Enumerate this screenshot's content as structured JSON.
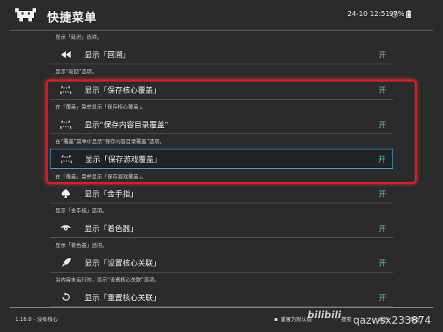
{
  "header": {
    "title": "快捷菜单",
    "clock": "24-10 12:51",
    "battery": "97%"
  },
  "items": [
    {
      "icon": "rewind-icon",
      "label": "显示「回溯」",
      "value": "开",
      "sub": "显示“返回”选项。"
    },
    {
      "icon": "overlay-icon",
      "label": "显示「保存核心覆盖」",
      "value": "开",
      "sub": "在「覆盖」菜单显示「保存核心覆盖」。"
    },
    {
      "icon": "overlay-icon",
      "label": "显示“保存内容目录覆盖”",
      "value": "开",
      "sub": "在“覆盖”菜单中显示“保存内容目录覆盖”选项。"
    },
    {
      "icon": "overlay-icon",
      "label": "显示「保存游戏覆盖」",
      "value": "开",
      "sub": "在「覆盖」菜单显示「保存游戏覆盖」。"
    },
    {
      "icon": "spade-icon",
      "label": "显示「金手指」",
      "value": "开",
      "sub": "显示「金手指」选项。"
    },
    {
      "icon": "eye-icon",
      "label": "显示「着色器」",
      "value": "开",
      "sub": "显示「着色器」选项。"
    },
    {
      "icon": "rocket-icon",
      "label": "显示「设置核心关联」",
      "value": "开",
      "sub": "当内容未运行时，显示“设置核心关联”选项。"
    },
    {
      "icon": "reset-icon",
      "label": "显示「重置核心关联」",
      "value": "开"
    }
  ],
  "top_sub": "显示「延迟」选项。",
  "footer": {
    "version": "1.16.0 - 没有核心",
    "reset_label": "重置为默认值",
    "search_label": "搜索",
    "back_label": "返回",
    "ok_label": "确定"
  },
  "watermark": {
    "brand": "bilibili",
    "user": "qazwsx233874"
  },
  "colors": {
    "accent_on": "#5fd7a8",
    "selection_border": "#4aa3d8",
    "highlight_box": "#d0202a",
    "background": "#2b2b2b"
  }
}
